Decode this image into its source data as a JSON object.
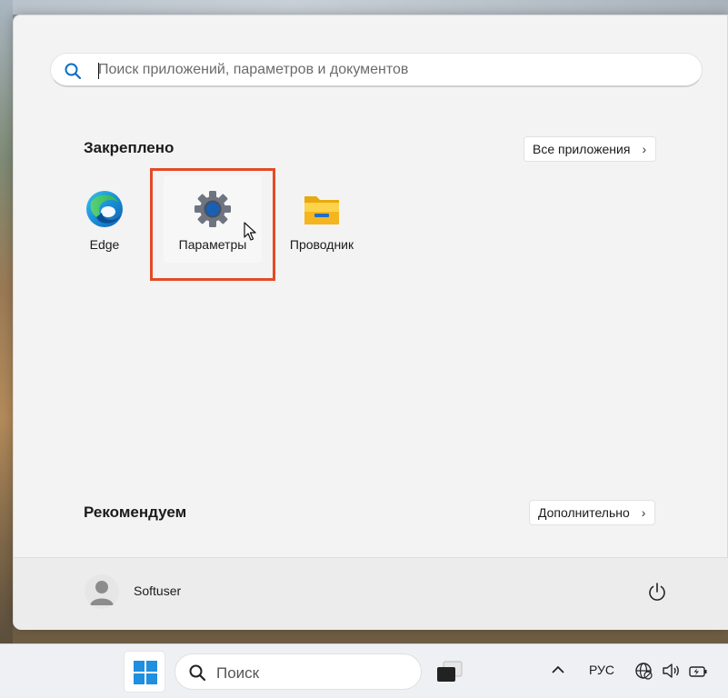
{
  "search": {
    "placeholder": "Поиск приложений, параметров и документов"
  },
  "pinned": {
    "title": "Закреплено",
    "all_apps_label": "Все приложения",
    "apps": [
      {
        "label": "Edge",
        "icon": "edge-icon"
      },
      {
        "label": "Параметры",
        "icon": "settings-gear-icon"
      },
      {
        "label": "Проводник",
        "icon": "folder-icon"
      }
    ]
  },
  "recommended": {
    "title": "Рекомендуем",
    "more_label": "Дополнительно"
  },
  "footer": {
    "user_name": "Softuser",
    "power_icon": "power-icon"
  },
  "taskbar": {
    "search_label": "Поиск",
    "language": "РУС",
    "tray_icons": [
      "chevron-up-icon",
      "network-icon",
      "volume-icon",
      "battery-icon"
    ]
  },
  "colors": {
    "highlight": "#e34a28",
    "accent": "#0078d4"
  }
}
